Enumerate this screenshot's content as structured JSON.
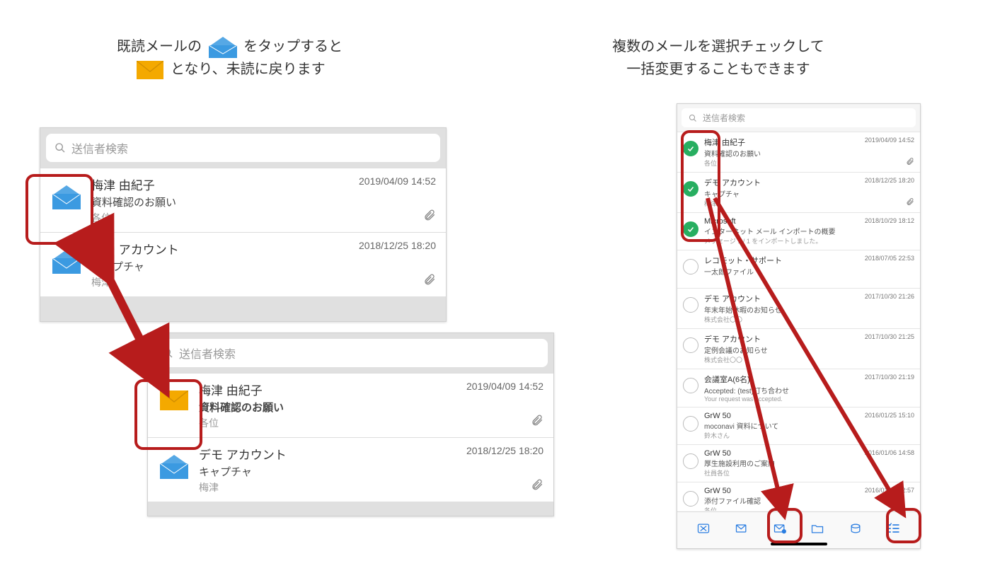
{
  "captions": {
    "left_line1_before": "既読メールの",
    "left_line1_after": "をタップすると",
    "left_line2_before": "となり、未読に戻ります",
    "right_line1": "複数のメールを選択チェックして",
    "right_line2": "一括変更することもできます"
  },
  "search_placeholder": "送信者検索",
  "panelA": {
    "rows": [
      {
        "sender": "梅津 由紀子",
        "subject": "資料確認のお願い",
        "preview": "各位",
        "date": "2019/04/09 14:52",
        "attach": true,
        "unread": false
      },
      {
        "sender": "デモ アカウント",
        "subject": "キャプチャ",
        "preview": "梅津",
        "date": "2018/12/25 18:20",
        "attach": true,
        "unread": false
      }
    ]
  },
  "panelB": {
    "rows": [
      {
        "sender": "梅津 由紀子",
        "subject": "資料確認のお願い",
        "preview": "各位",
        "date": "2019/04/09 14:52",
        "attach": true,
        "unread": true,
        "bold": true
      },
      {
        "sender": "デモ アカウント",
        "subject": "キャプチャ",
        "preview": "梅津",
        "date": "2018/12/25 18:20",
        "attach": true,
        "unread": false
      }
    ]
  },
  "panelC": {
    "rows": [
      {
        "sender": "梅津 由紀子",
        "subject": "資料確認のお願い",
        "preview": "各位",
        "date": "2019/04/09 14:52",
        "checked": true,
        "attach": true
      },
      {
        "sender": "デモ アカウント",
        "subject": "キャプチャ",
        "preview": "梅津",
        "date": "2018/12/25 18:20",
        "checked": true,
        "attach": true
      },
      {
        "sender": "Microsoft",
        "subject": "インターネット メール インポートの概要",
        "preview": "メッセージ 1 / 1 をインポートしました。",
        "date": "2018/10/29 18:12",
        "checked": true,
        "attach": false
      },
      {
        "sender": "レコモット・サポート",
        "subject": "一太郎ファイル",
        "preview": "",
        "date": "2018/07/05 22:53",
        "checked": false,
        "attach": false
      },
      {
        "sender": "デモ アカウント",
        "subject": "年末年始休暇のお知らせ",
        "preview": "株式会社〇〇",
        "date": "2017/10/30 21:26",
        "checked": false,
        "attach": false
      },
      {
        "sender": "デモ アカウント",
        "subject": "定例会議のお知らせ",
        "preview": "株式会社〇〇",
        "date": "2017/10/30 21:25",
        "checked": false,
        "attach": false
      },
      {
        "sender": "会議室A(6名)",
        "subject": "Accepted: (test)打ち合わせ",
        "preview": "Your request was accepted.",
        "date": "2017/10/30 21:19",
        "checked": false,
        "attach": false
      },
      {
        "sender": "GrW 50",
        "subject": "moconavi 資料について",
        "preview": "鈴木さん",
        "date": "2016/01/25 15:10",
        "checked": false,
        "attach": false
      },
      {
        "sender": "GrW 50",
        "subject": "厚生施設利用のご案内",
        "preview": "社員各位",
        "date": "2016/01/06 14:58",
        "checked": false,
        "attach": false
      },
      {
        "sender": "GrW 50",
        "subject": "添付ファイル確認",
        "preview": "各位",
        "date": "2016/01/16 12:57",
        "checked": false,
        "attach": false
      }
    ]
  }
}
